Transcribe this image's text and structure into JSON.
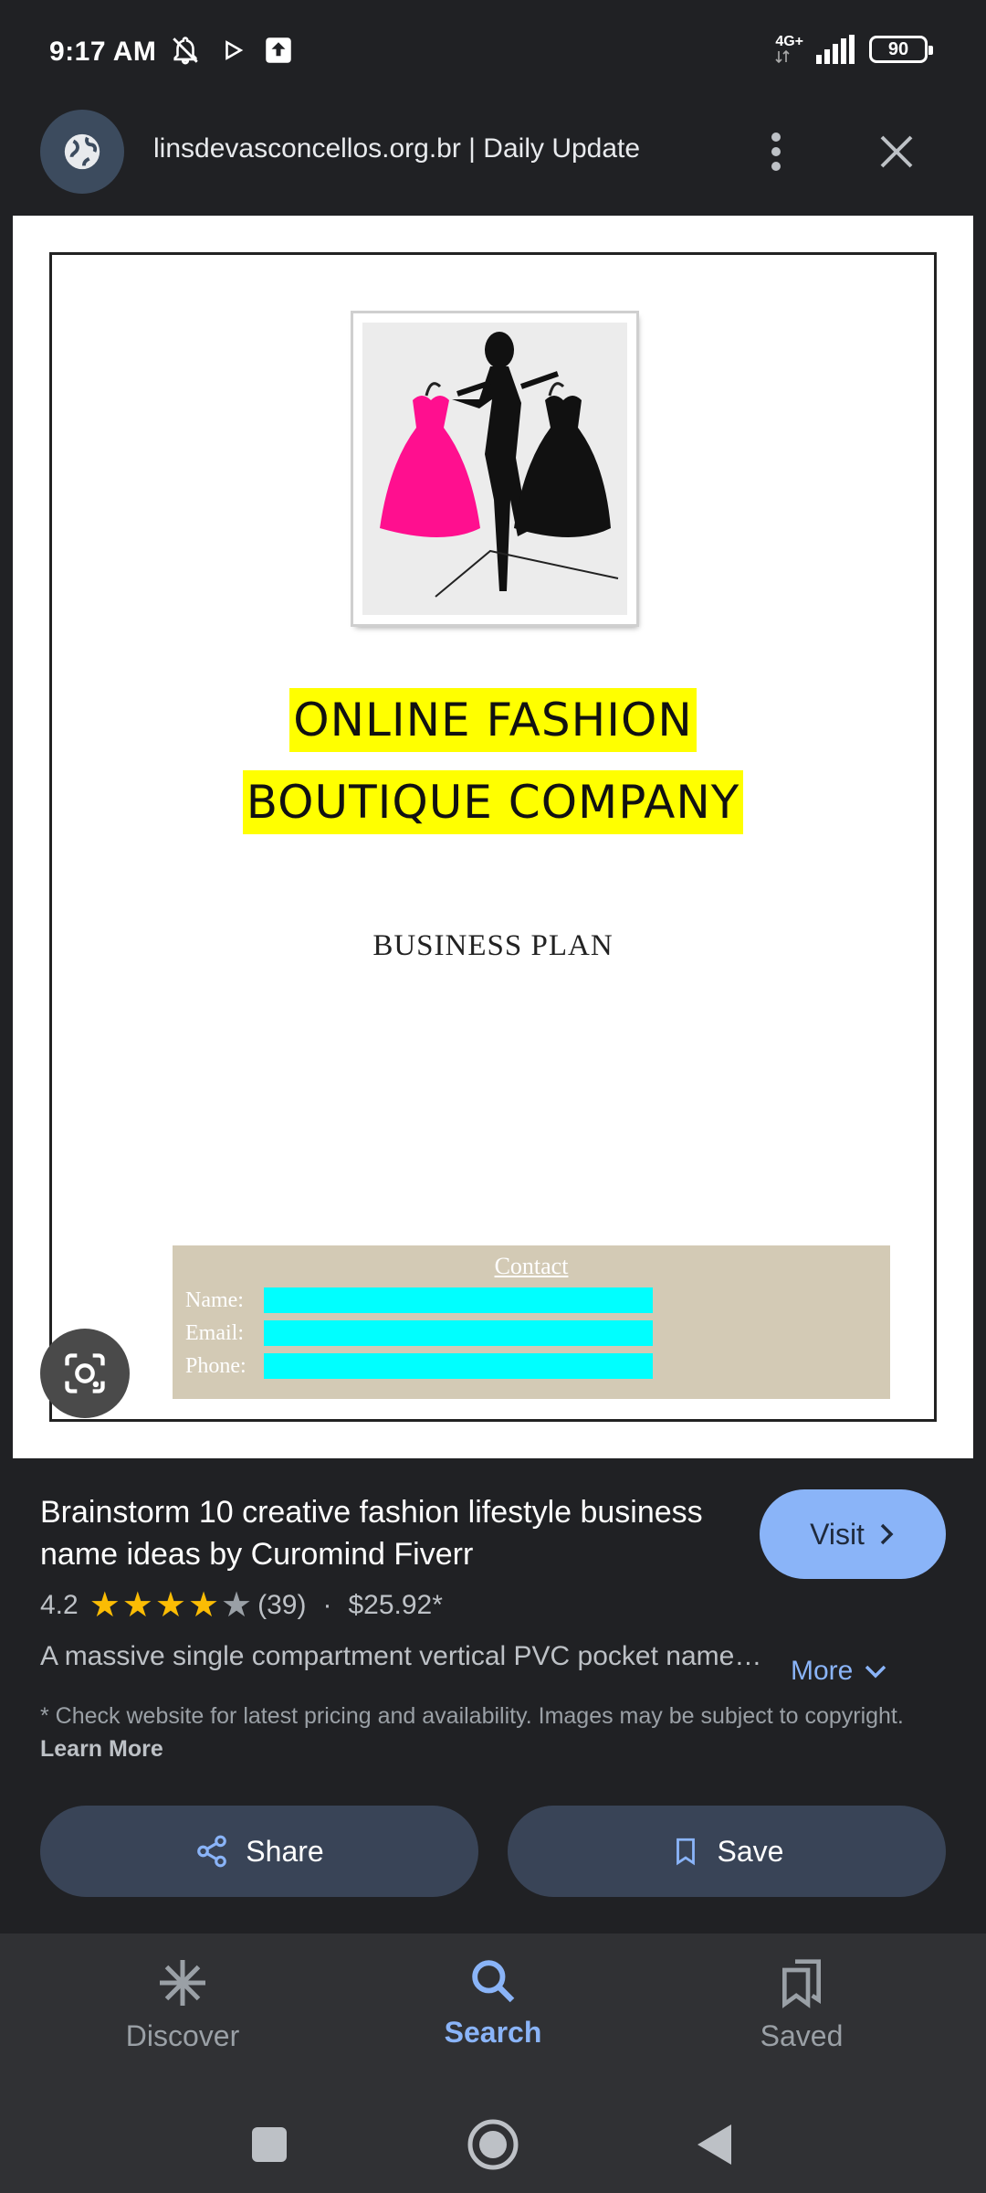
{
  "status_bar": {
    "time": "9:17 AM",
    "network": "4G+",
    "battery": "90"
  },
  "header": {
    "title": "linsdevasconcellos.org.br | Daily Update",
    "site_icon": "globe-icon",
    "menu_icon": "more-vert-icon",
    "close_icon": "close-icon"
  },
  "document": {
    "title_line1": "ONLINE FASHION",
    "title_line2": "BOUTIQUE COMPANY",
    "subtitle": "BUSINESS PLAN",
    "contact_heading": "Contact",
    "contact_name_label": "Name:",
    "contact_email_label": "Email:",
    "contact_phone_label": "Phone:",
    "highlight_color": "#ffff00",
    "field_color": "#00ffff"
  },
  "result": {
    "title": "Brainstorm 10 creative fashion lifestyle business name ideas by Curomind Fiverr",
    "visit_label": "Visit",
    "rating": "4.2",
    "rating_value": 4.2,
    "review_count": "(39)",
    "separator": "·",
    "price": "$25.92*",
    "description": "A massive single compartment vertical PVC pocket name…",
    "more_label": "More",
    "disclaimer": "* Check website for latest pricing and availability. Images may be subject to copyright.",
    "learn_more": "Learn More",
    "share_label": "Share",
    "save_label": "Save",
    "star_color": "#fbbc04"
  },
  "bottom_nav": {
    "discover": "Discover",
    "search": "Search",
    "saved": "Saved",
    "active": "search"
  }
}
